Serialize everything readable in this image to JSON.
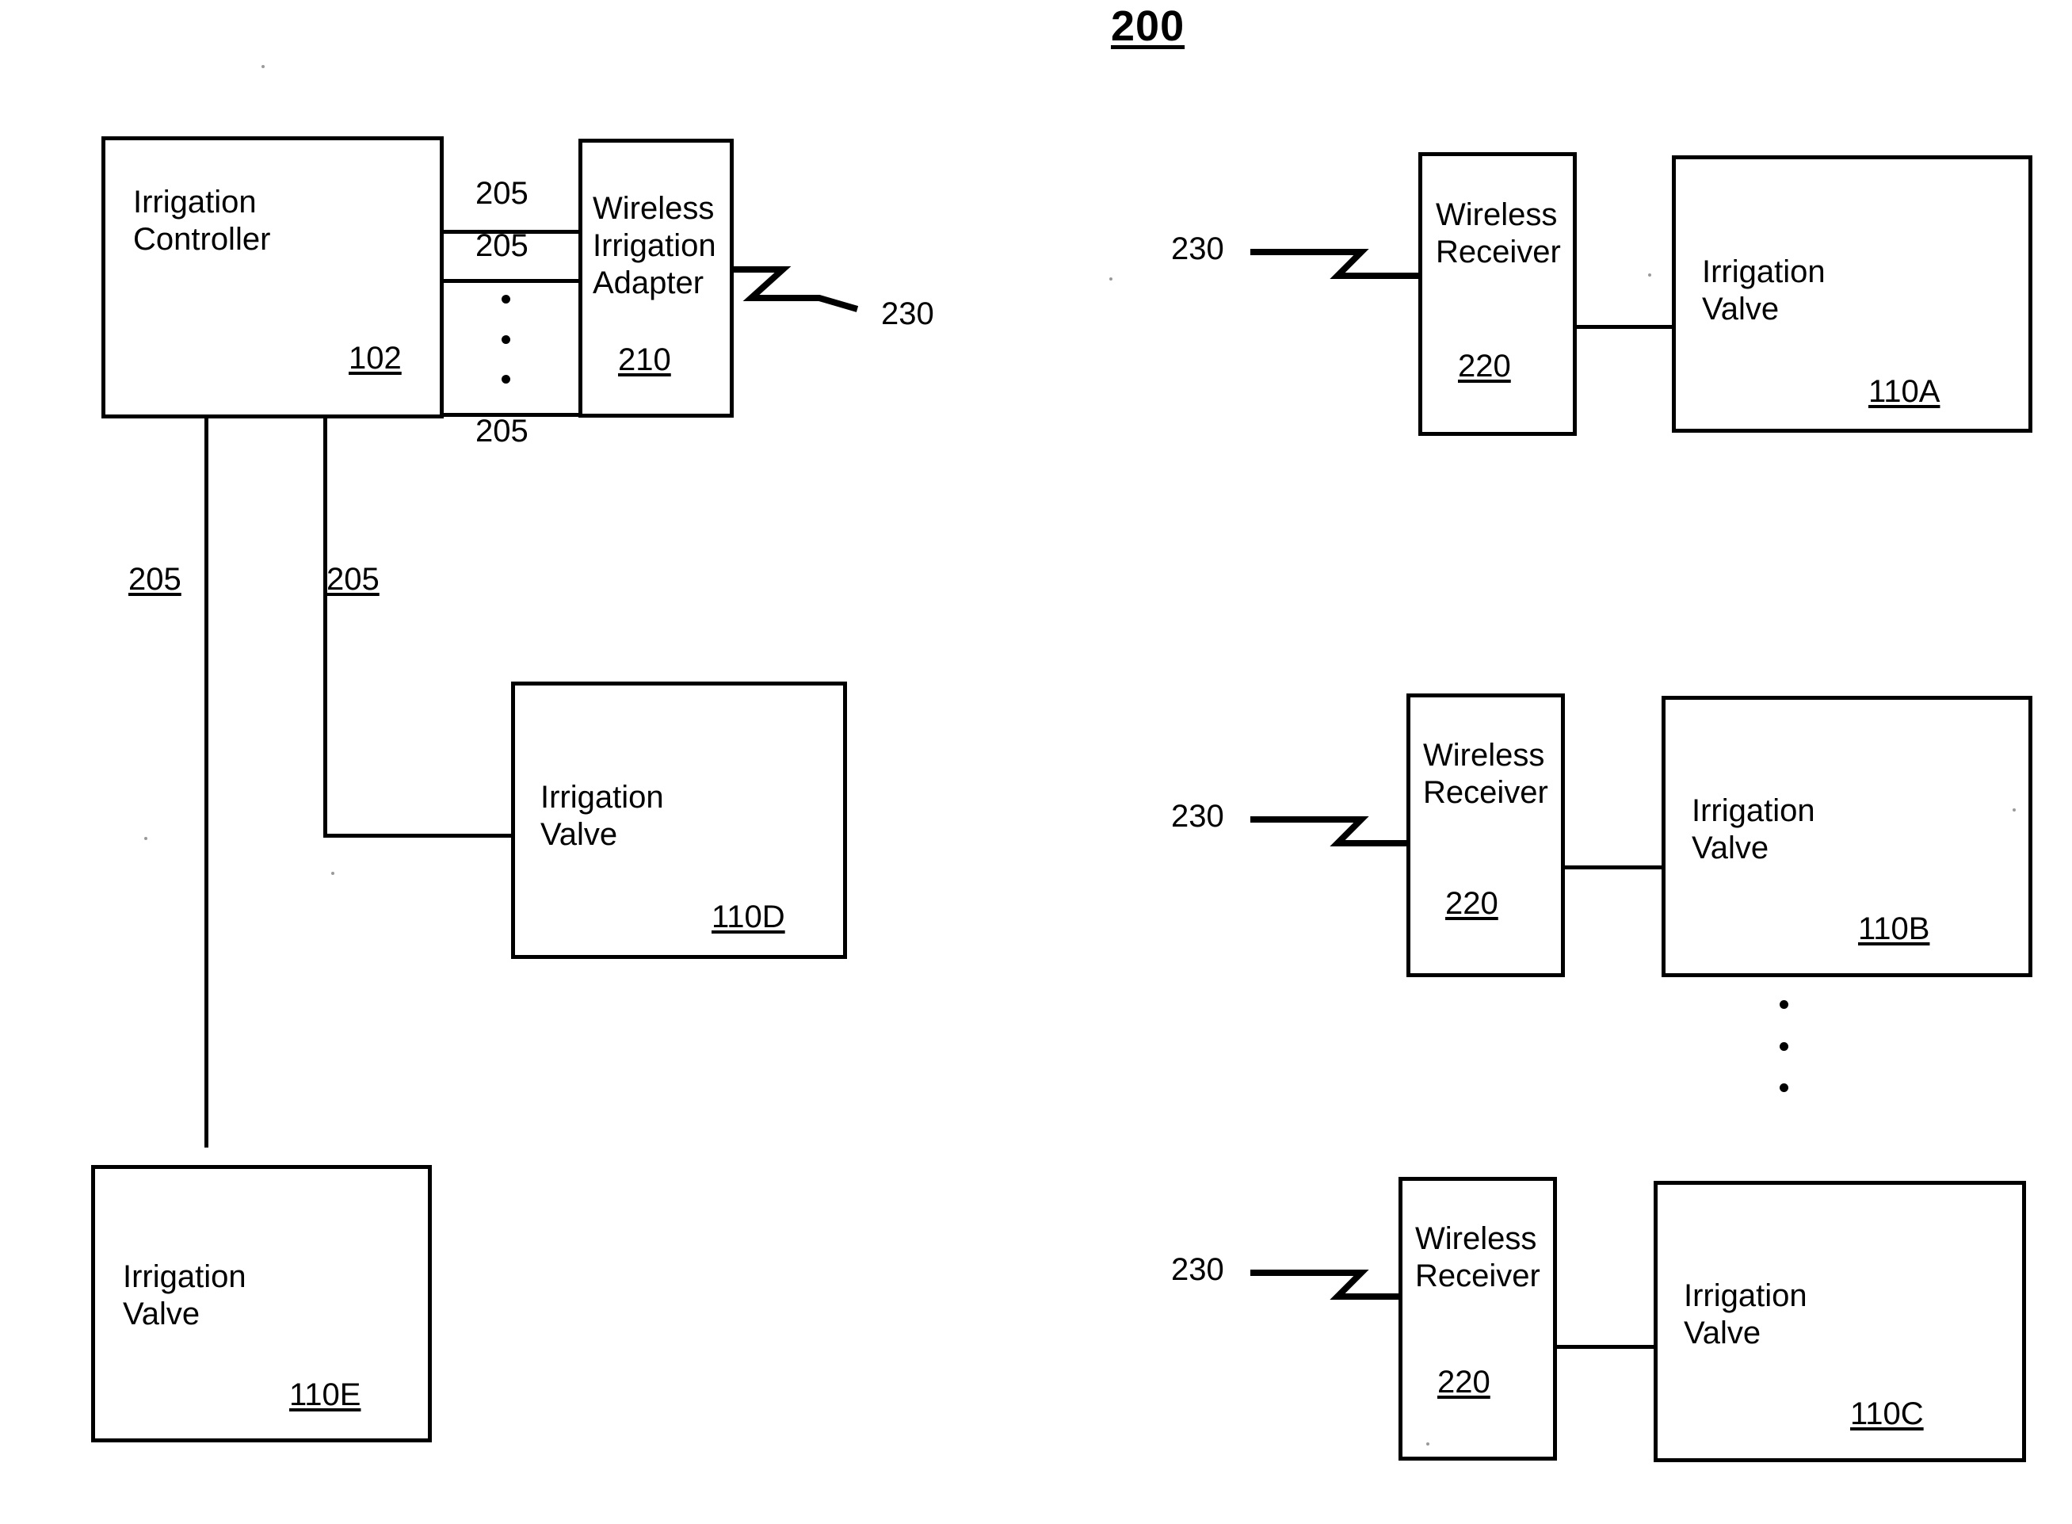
{
  "figure": {
    "number": "200",
    "type": "patent-block-diagram"
  },
  "blocks": {
    "irrigation_controller": {
      "title": "Irrigation\nController",
      "ref": "102"
    },
    "wireless_irrigation_adapter": {
      "title": "Wireless\nIrrigation\nAdapter",
      "ref": "210"
    },
    "irrigation_valve_d": {
      "title": "Irrigation\nValve",
      "ref": "110D"
    },
    "irrigation_valve_e": {
      "title": "Irrigation\nValve",
      "ref": "110E"
    },
    "wireless_receiver_a": {
      "title": "Wireless\nReceiver",
      "ref": "220"
    },
    "irrigation_valve_a": {
      "title": "Irrigation\nValve",
      "ref": "110A"
    },
    "wireless_receiver_b": {
      "title": "Wireless\nReceiver",
      "ref": "220"
    },
    "irrigation_valve_b": {
      "title": "Irrigation\nValve",
      "ref": "110B"
    },
    "wireless_receiver_c": {
      "title": "Wireless\nReceiver",
      "ref": "220"
    },
    "irrigation_valve_c": {
      "title": "Irrigation\nValve",
      "ref": "110C"
    }
  },
  "wire_labels": {
    "w1": "205",
    "w2": "205",
    "w3": "205",
    "w4": "205",
    "w5": "205"
  },
  "signal_labels": {
    "adapter_tx": "230",
    "rx_a": "230",
    "rx_b": "230",
    "rx_c": "230"
  },
  "colors": {
    "stroke": "#000000",
    "background": "#ffffff"
  }
}
